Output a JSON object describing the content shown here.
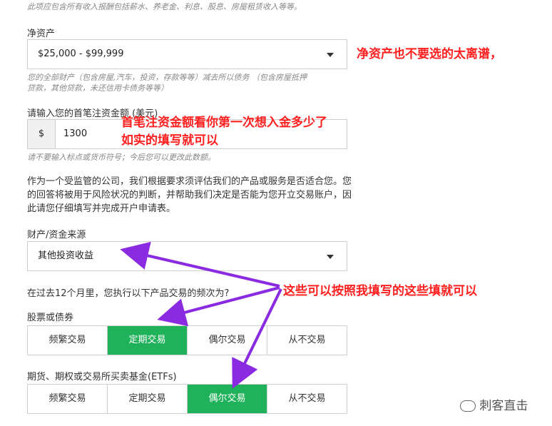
{
  "top_hint": "此项应包含所有收入报酬包括薪水、养老金、利息、股息、房屋租赁收入等等。",
  "net_assets": {
    "label": "净资产",
    "value": "$25,000 - $99,999",
    "hint_line1": "您的全部财产（包含房屋,汽车，投资，存款等等）减去所以债务    （包含房屋抵押",
    "hint_line2": "贷款，其他贷款，未还信用卡债务等等）",
    "annotation": "净资产也不要选的太离谱，"
  },
  "deposit": {
    "label": "请输入您的首笔注资金额 (美元)",
    "prefix": "$",
    "value": "1300",
    "hint": "请不要输入标点或货币符号；今后您可以更改此数额。",
    "annotation_line1": "首笔注资金额看你第一次想入金多少了",
    "annotation_line2": "如实的填写就可以"
  },
  "regulatory_note": {
    "line1": "作为一个受监管的公司，我们根据要求须评估我们的产品或服务是否适合您。您",
    "line2": "的回答将被用于风险状况的判断，并帮助我们决定是否能为您开立交易账户，因",
    "line3": "此请您仔细填写并完成开户申请表。"
  },
  "wealth_source": {
    "label": "财产/资金来源",
    "value": "其他投资收益"
  },
  "frequency_question": "在过去12个月里，您执行以下产品交易的频次为?",
  "frequency_annotation": "这些可以按照我填写的这些填就可以",
  "stocks": {
    "label": "股票或债券",
    "options": [
      "频繁交易",
      "定期交易",
      "偶尔交易",
      "从不交易"
    ],
    "selected_index": 1
  },
  "futures": {
    "label": "期货、期权或交易所买卖基金(ETFs)",
    "options": [
      "频繁交易",
      "定期交易",
      "偶尔交易",
      "从不交易"
    ],
    "selected_index": 2
  },
  "watermark": "刺客直击",
  "colors": {
    "accent_green": "#20b25a",
    "annotation_red": "#ff1f1f",
    "arrow_purple": "#8a2be2"
  }
}
